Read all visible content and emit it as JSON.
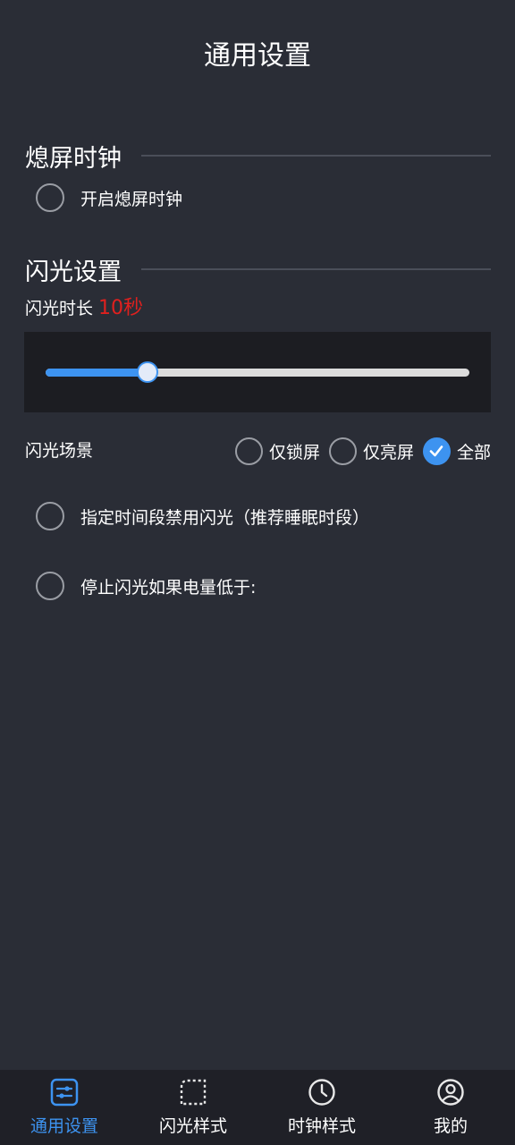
{
  "header": {
    "title": "通用设置"
  },
  "screen_off_clock": {
    "section_title": "熄屏时钟",
    "enable_label": "开启熄屏时钟",
    "enabled": false
  },
  "flash": {
    "section_title": "闪光设置",
    "duration_label": "闪光时长",
    "duration_value": "10秒",
    "slider_fraction": 0.24,
    "scene_label": "闪光场景",
    "scene_options": [
      {
        "label": "仅锁屏",
        "checked": false
      },
      {
        "label": "仅亮屏",
        "checked": false
      },
      {
        "label": "全部",
        "checked": true
      }
    ],
    "disable_period_label": "指定时间段禁用闪光（推荐睡眠时段）",
    "disable_period_enabled": false,
    "low_battery_label": "停止闪光如果电量低于:",
    "low_battery_enabled": false
  },
  "bottom_nav": {
    "items": [
      {
        "label": "通用设置",
        "icon": "sliders-icon",
        "active": true
      },
      {
        "label": "闪光样式",
        "icon": "dashed-frame-icon",
        "active": false
      },
      {
        "label": "时钟样式",
        "icon": "clock-icon",
        "active": false
      },
      {
        "label": "我的",
        "icon": "user-icon",
        "active": false
      }
    ]
  },
  "colors": {
    "background": "#2a2d36",
    "accent": "#3d93f0",
    "duration_value": "#e0201e",
    "nav_background": "#1f2027"
  }
}
